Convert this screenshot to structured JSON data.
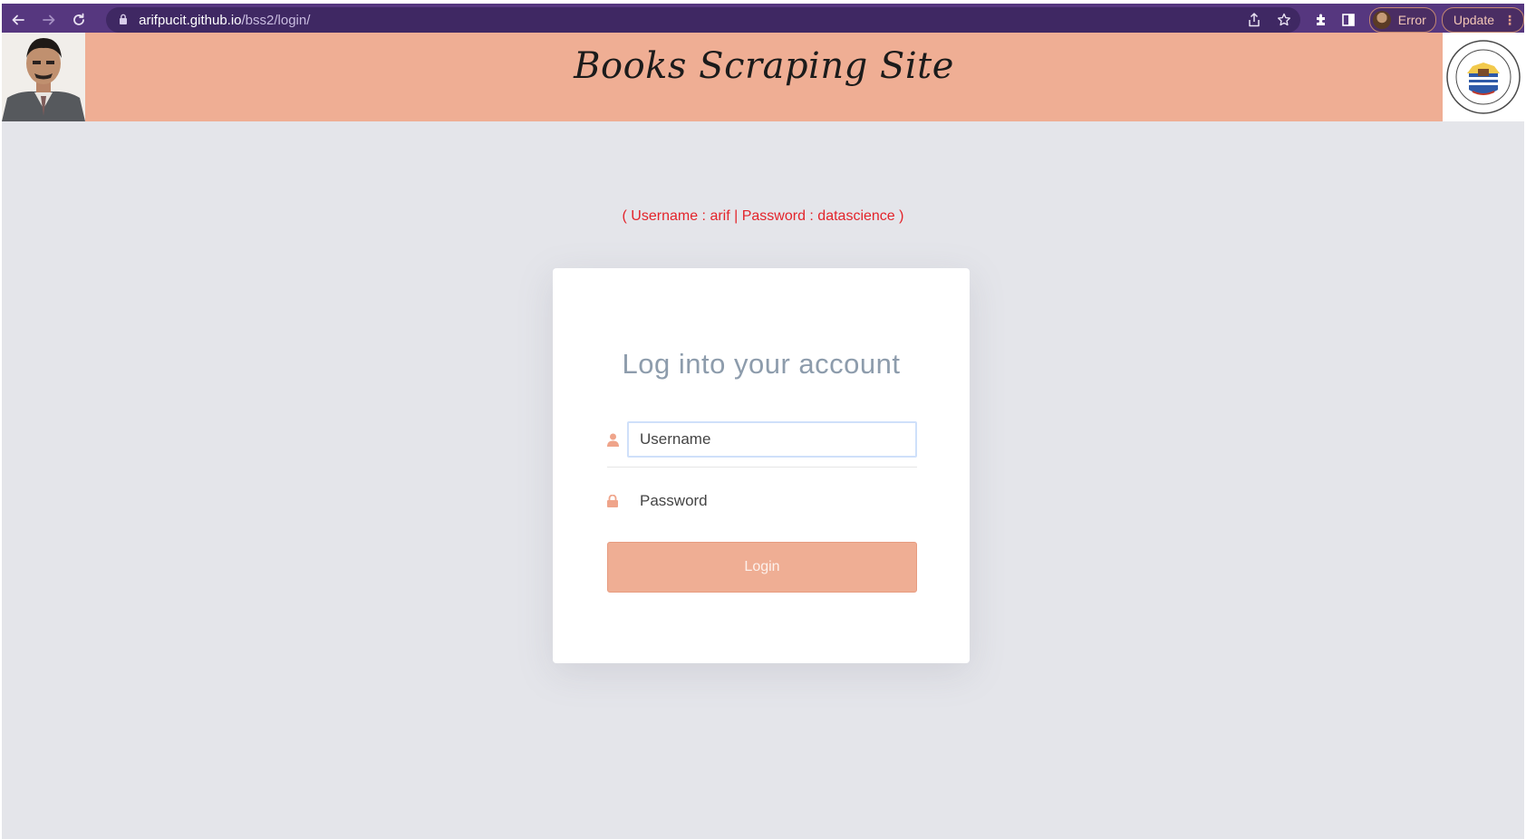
{
  "browser": {
    "url_host": "arifpucit.github.io",
    "url_path": "/bss2/login/",
    "profile_label": "Error",
    "update_label": "Update",
    "icons": [
      "back-icon",
      "forward-icon",
      "reload-icon",
      "lock-icon",
      "share-icon",
      "star-icon",
      "extensions-icon",
      "sidepanel-icon",
      "menu-icon"
    ]
  },
  "header": {
    "title": "Books Scraping Site"
  },
  "main": {
    "hint": "( Username : arif | Password : datascience )",
    "card": {
      "title": "Log into your account",
      "username_placeholder": "Username",
      "password_placeholder": "Password",
      "login_label": "Login"
    }
  },
  "colors": {
    "accent": "#efae94",
    "chrome": "#56377f",
    "hint": "#e3242b",
    "background": "#e4e5ea"
  }
}
